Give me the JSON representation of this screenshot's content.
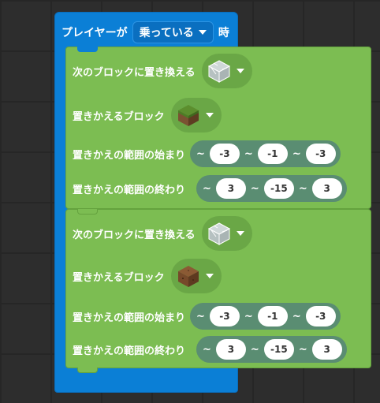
{
  "hat": {
    "prefix": "プレイヤーが",
    "dropdown": "乗っている",
    "suffix": "時"
  },
  "blocks": [
    {
      "replace_label": "次のブロックに置き換える",
      "replace_block": "glass",
      "target_label": "置きかえるブロック",
      "target_block": "grass-block",
      "start_label": "置きかえの範囲の始まり",
      "start": [
        "-3",
        "-1",
        "-3"
      ],
      "end_label": "置きかえの範囲の終わり",
      "end": [
        "3",
        "-15",
        "3"
      ]
    },
    {
      "replace_label": "次のブロックに置き換える",
      "replace_block": "glass",
      "target_label": "置きかえるブロック",
      "target_block": "dirt-block",
      "start_label": "置きかえの範囲の始まり",
      "start": [
        "-3",
        "-1",
        "-3"
      ],
      "end_label": "置きかえの範囲の終わり",
      "end": [
        "3",
        "-15",
        "3"
      ]
    }
  ],
  "tilde": "~",
  "colors": {
    "hat": "#0b7fd6",
    "block": "#7cbd52",
    "coords_bg": "#5a8d72"
  }
}
